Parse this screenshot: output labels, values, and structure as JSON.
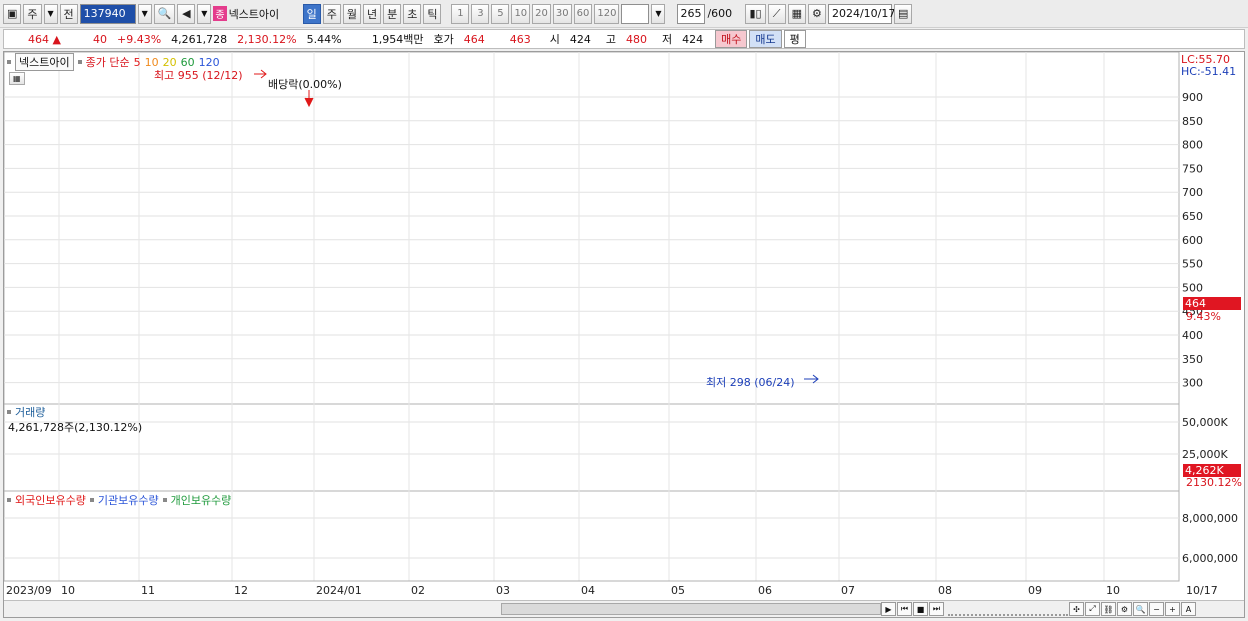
{
  "toolbar": {
    "market": "주",
    "prev_label": "전",
    "code": "137940",
    "tag": "종",
    "stock_name": "넥스트아이",
    "periods": [
      "일",
      "주",
      "월",
      "년",
      "분",
      "초",
      "틱"
    ],
    "selected_period": "일",
    "intervals": [
      "1",
      "3",
      "5",
      "10",
      "20",
      "30",
      "60",
      "120"
    ],
    "count": "265",
    "count_max": "/600",
    "date": "2024/10/17"
  },
  "quote": {
    "price": "464",
    "change": "40",
    "change_pct": "+9.43%",
    "volume": "4,261,728",
    "volume_pct": "2,130.12%",
    "turnover": "5.44%",
    "amount": "1,954백만",
    "ask_label": "호가",
    "ask1": "464",
    "ask2": "463",
    "open_label": "시",
    "open": "424",
    "high_label": "고",
    "high": "480",
    "low_label": "저",
    "low": "424",
    "buy_label": "매수",
    "sell_label": "매도",
    "flat_label": "평"
  },
  "chart": {
    "legend_name": "넥스트아이",
    "legend_text": "종가 단순",
    "ma_periods": [
      {
        "label": "5",
        "color": "#e01818"
      },
      {
        "label": "10",
        "color": "#f08a1c"
      },
      {
        "label": "20",
        "color": "#e8d400"
      },
      {
        "label": "60",
        "color": "#1f9a3c"
      },
      {
        "label": "120",
        "color": "#2b55d8"
      }
    ],
    "high_note": "최고 955 (12/12)",
    "dividend_note": "배당락(0.00%)",
    "low_note": "최저 298 (06/24)",
    "lc": "LC:55.70",
    "hc": "HC:-51.41",
    "last_price_tag": "464",
    "last_pct_tag": "9.43%",
    "price_ticks": [
      "900",
      "850",
      "800",
      "750",
      "700",
      "650",
      "600",
      "550",
      "500",
      "450",
      "400",
      "350",
      "300"
    ],
    "volume_title": "거래량",
    "volume_text": "4,261,728주(2,130.12%)",
    "volume_ticks": [
      "50,000K",
      "25,000K"
    ],
    "volume_tag": "4,262K",
    "volume_pct_tag": "2130.12%",
    "holdings": [
      {
        "label": "외국인보유수량",
        "color": "#e01818"
      },
      {
        "label": "기관보유수량",
        "color": "#2b55d8"
      },
      {
        "label": "개인보유수량",
        "color": "#1f9a3c"
      }
    ],
    "holding_ticks": [
      "8,000,000",
      "6,000,000"
    ],
    "x_labels": [
      "2023/09",
      "10",
      "11",
      "12",
      "2024/01",
      "02",
      "03",
      "04",
      "05",
      "06",
      "07",
      "08",
      "09",
      "10",
      "10/17"
    ]
  }
}
